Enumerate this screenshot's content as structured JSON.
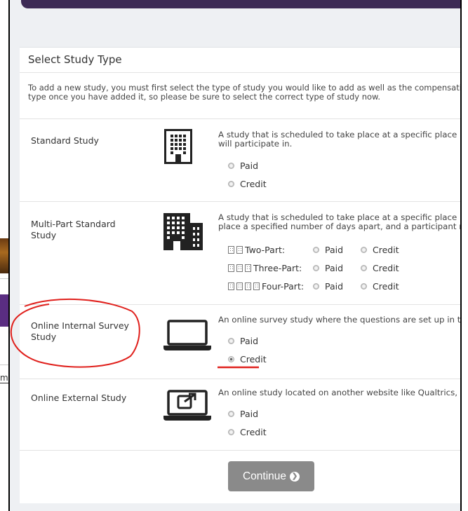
{
  "background": {
    "left_text_fragment": "m"
  },
  "card": {
    "title": "Select Study Type",
    "intro_line1": "To add a new study, you must first select the type of study you would like to add as well as the compensatio",
    "intro_line2": "type once you have added it, so please be sure to select the correct type of study now."
  },
  "studies": [
    {
      "name": "Standard Study",
      "icon": "building-icon",
      "desc_line1": "A study that is scheduled to take place at a specific place (i.e.",
      "desc_line2": "will participate in.",
      "options": [
        "Paid",
        "Credit"
      ],
      "selected": null
    },
    {
      "name": "Multi-Part Standard Study",
      "icon": "buildings-icon",
      "desc_line1": "A study that is scheduled to take place at a specific place (i.e.",
      "desc_line2": "place a specified number of days apart, and a participant mu",
      "parts": [
        {
          "label": "Two-Part:",
          "icons": 2
        },
        {
          "label": "Three-Part:",
          "icons": 3
        },
        {
          "label": "Four-Part:",
          "icons": 4
        }
      ],
      "options": [
        "Paid",
        "Credit"
      ]
    },
    {
      "name": "Online Internal Survey Study",
      "icon": "laptop-icon",
      "desc_line1": "An online survey study where the questions are set up in the",
      "options": [
        "Paid",
        "Credit"
      ],
      "selected": "Credit"
    },
    {
      "name": "Online External Study",
      "icon": "laptop-external-link-icon",
      "desc_line1": "An online study located on another website like Qualtrics, Su",
      "options": [
        "Paid",
        "Credit"
      ],
      "selected": null
    }
  ],
  "continue_button": {
    "label": "Continue",
    "icon": "chevron-right-circle-icon"
  },
  "annotation": {
    "color": "#e0201c"
  },
  "colors": {
    "topbar": "#3d2a55",
    "button": "#8a8a8a",
    "annotation": "#e0201c"
  }
}
